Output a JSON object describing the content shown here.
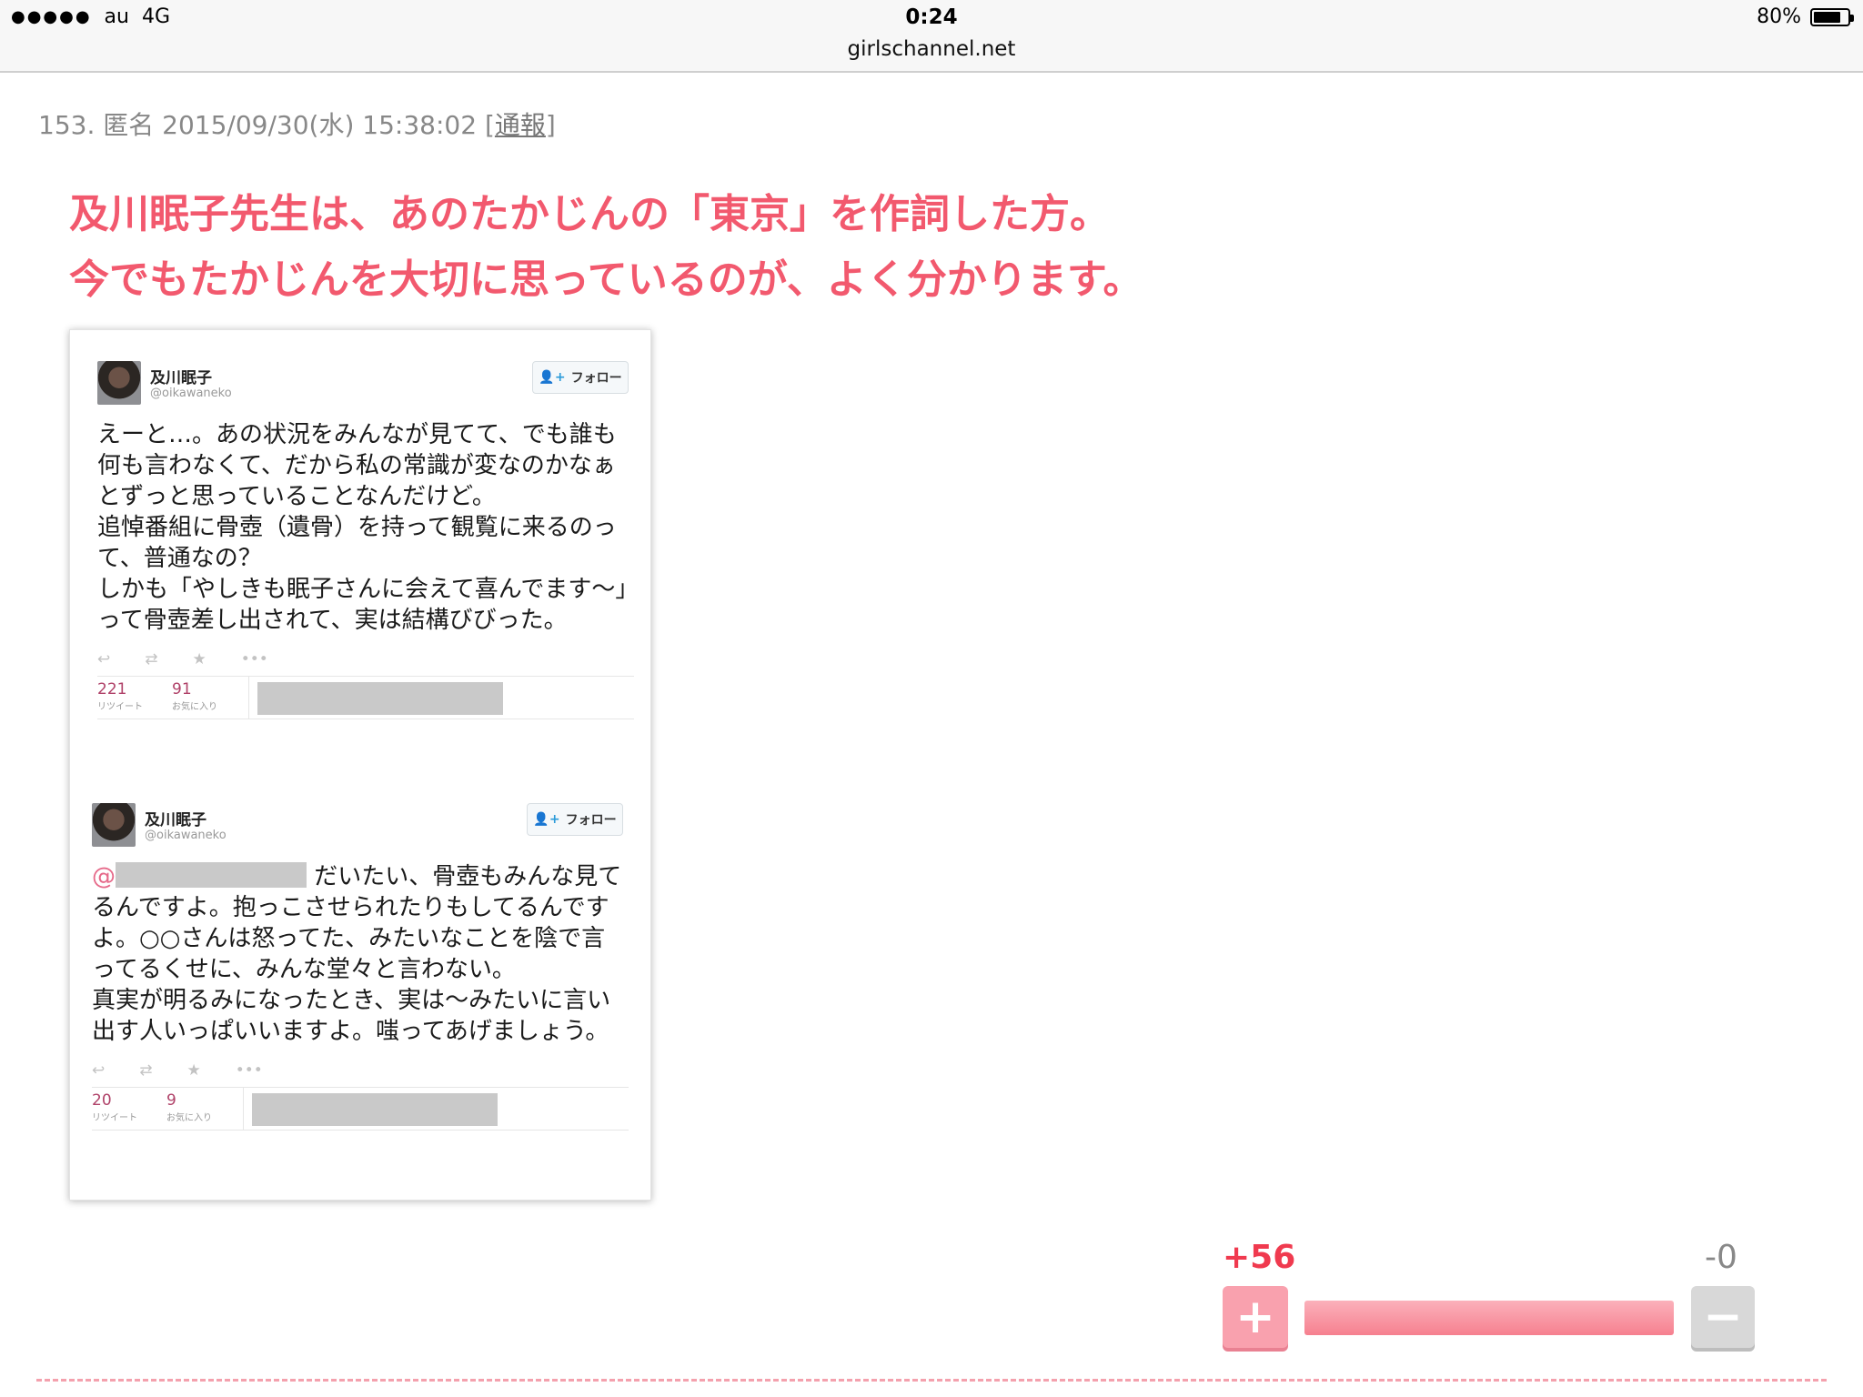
{
  "status_bar": {
    "carrier": "au",
    "network": "4G",
    "time": "0:24",
    "url": "girlschannel.net",
    "battery": "80%",
    "battery_level": 0.8
  },
  "comment": {
    "number": "153.",
    "author": "匿名",
    "datetime": "2015/09/30(水) 15:38:02",
    "report_open": "[",
    "report_label": "通報",
    "report_close": "]",
    "lines": [
      "及川眠子先生は、あのたかじんの「東京」を作詞した方。",
      "今でもたかじんを大切に思っているのが、よく分かります。"
    ]
  },
  "tweets": [
    {
      "name": "及川眠子",
      "handle": "@oikawaneko",
      "follow_label": "フォロー",
      "body": "えーと…。あの状況をみんなが見てて、でも誰も何も言わなくて、だから私の常識が変なのかなぁとずっと思っていることなんだけど。\n追悼番組に骨壺（遺骨）を持って観覧に来るのって、普通なの？\nしかも「やしきも眠子さんに会えて喜んでます〜」って骨壺差し出されて、実は結構びびった。",
      "retweets": "221",
      "retweets_label": "リツイート",
      "favorites": "91",
      "favorites_label": "お気に入り"
    },
    {
      "name": "及川眠子",
      "handle": "@oikawaneko",
      "follow_label": "フォロー",
      "mention": "@",
      "body": "だいたい、骨壺もみんな見てるんですよ。抱っこさせられたりもしてるんですよ。○○さんは怒ってた、みたいなことを陰で言ってるくせに、みんな堂々と言わない。\n真実が明るみになったとき、実は〜みたいに言い出す人いっぱいいますよ。嗤ってあげましょう。",
      "retweets": "20",
      "retweets_label": "リツイート",
      "favorites": "9",
      "favorites_label": "お気に入り"
    }
  ],
  "votes": {
    "plus": "+56",
    "minus": "-0",
    "plus_symbol": "+",
    "minus_symbol": "−",
    "plus_ratio": 1.0
  },
  "icons": {
    "reply": "↩",
    "retweet": "⇄",
    "favorite": "★",
    "more": "•••",
    "follow": "👤+"
  },
  "colors": {
    "comment_text": "#f2596e",
    "plus_count": "#f03a4f",
    "plus_button": "#f9a1ae",
    "minus_button": "#d8d8d8"
  }
}
